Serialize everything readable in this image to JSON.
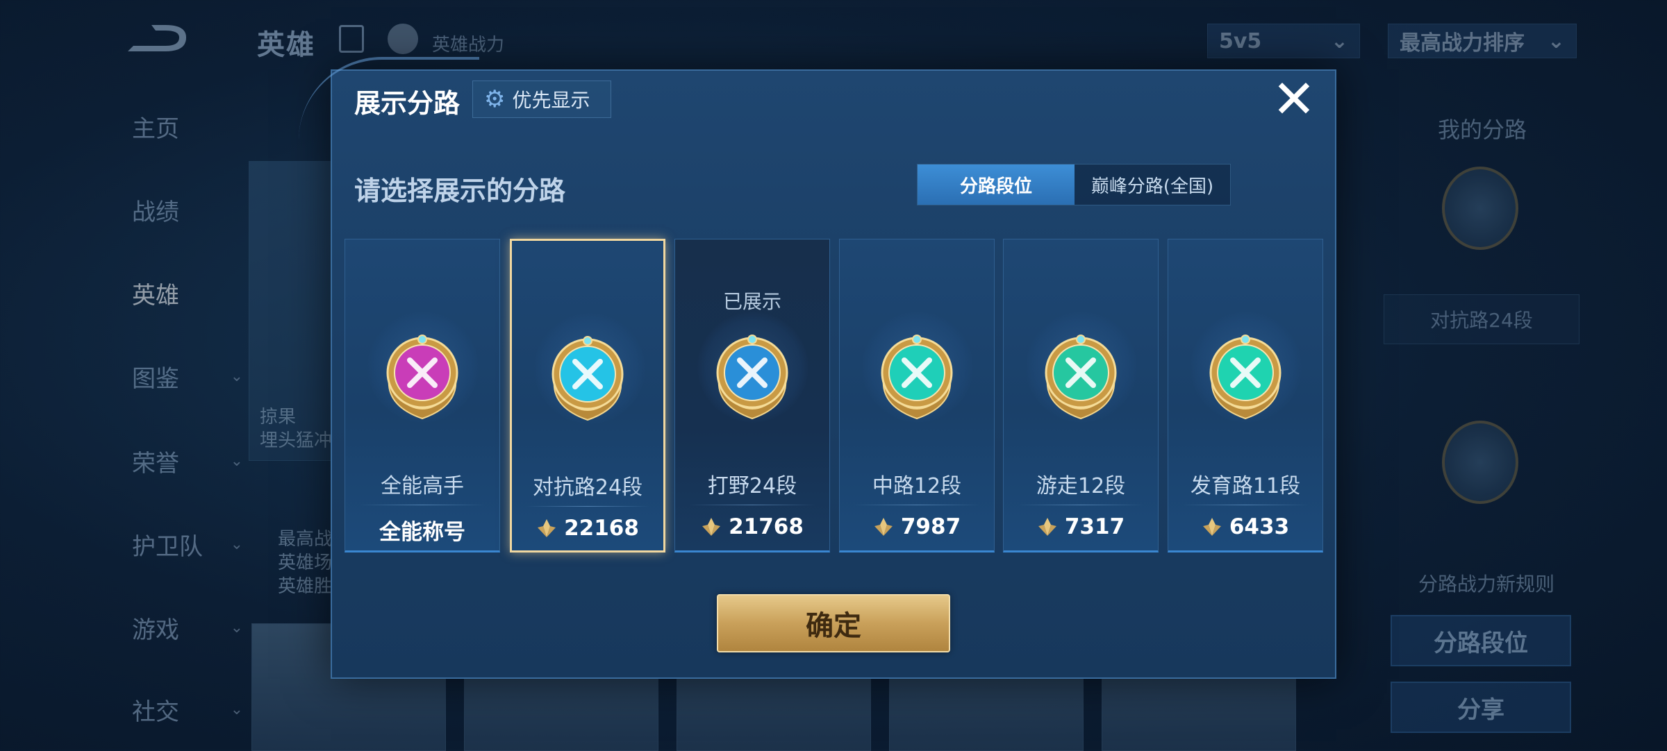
{
  "app": {
    "title": "英雄",
    "power_label": "英雄战力",
    "mode_select": "5v5",
    "sort_select": "最高战力排序"
  },
  "nav": {
    "items": [
      {
        "label": "主页",
        "has_chevron": false
      },
      {
        "label": "战绩",
        "has_chevron": false
      },
      {
        "label": "英雄",
        "has_chevron": false,
        "active": true
      },
      {
        "label": "图鉴",
        "has_chevron": true
      },
      {
        "label": "荣誉",
        "has_chevron": true
      },
      {
        "label": "护卫队",
        "has_chevron": true
      },
      {
        "label": "游戏",
        "has_chevron": true
      },
      {
        "label": "社交",
        "has_chevron": true
      }
    ]
  },
  "background_card": {
    "line1": "掠果",
    "line2": "埋头猛冲",
    "stats": [
      "最高战",
      "英雄场",
      "英雄胜"
    ]
  },
  "right_panel": {
    "title": "我的分路",
    "lane_label": "对抗路24段",
    "rule_label": "分路战力新规则",
    "lane_button": "分路段位",
    "share_button": "分享"
  },
  "modal": {
    "title": "展示分路",
    "priority_button": "优先显示",
    "subtitle": "请选择展示的分路",
    "tabs": [
      "分路段位",
      "巅峰分路(全国)"
    ],
    "confirm_button": "确定",
    "cards": [
      {
        "name": "全能高手",
        "value": "全能称号",
        "show_icon": false,
        "status": "",
        "badge": "allround",
        "color": "#c93db8"
      },
      {
        "name": "对抗路24段",
        "value": "22168",
        "show_icon": true,
        "status": "",
        "badge": "clash",
        "color": "#25c3e6",
        "selected": true
      },
      {
        "name": "打野24段",
        "value": "21768",
        "show_icon": true,
        "status": "已展示",
        "badge": "jungle",
        "color": "#2a8fd8"
      },
      {
        "name": "中路12段",
        "value": "7987",
        "show_icon": true,
        "status": "",
        "badge": "mid",
        "color": "#1fcfb8"
      },
      {
        "name": "游走12段",
        "value": "7317",
        "show_icon": true,
        "status": "",
        "badge": "roam",
        "color": "#26c7a0"
      },
      {
        "name": "发育路11段",
        "value": "6433",
        "show_icon": true,
        "status": "",
        "badge": "farm",
        "color": "#1fd3b0"
      }
    ]
  }
}
